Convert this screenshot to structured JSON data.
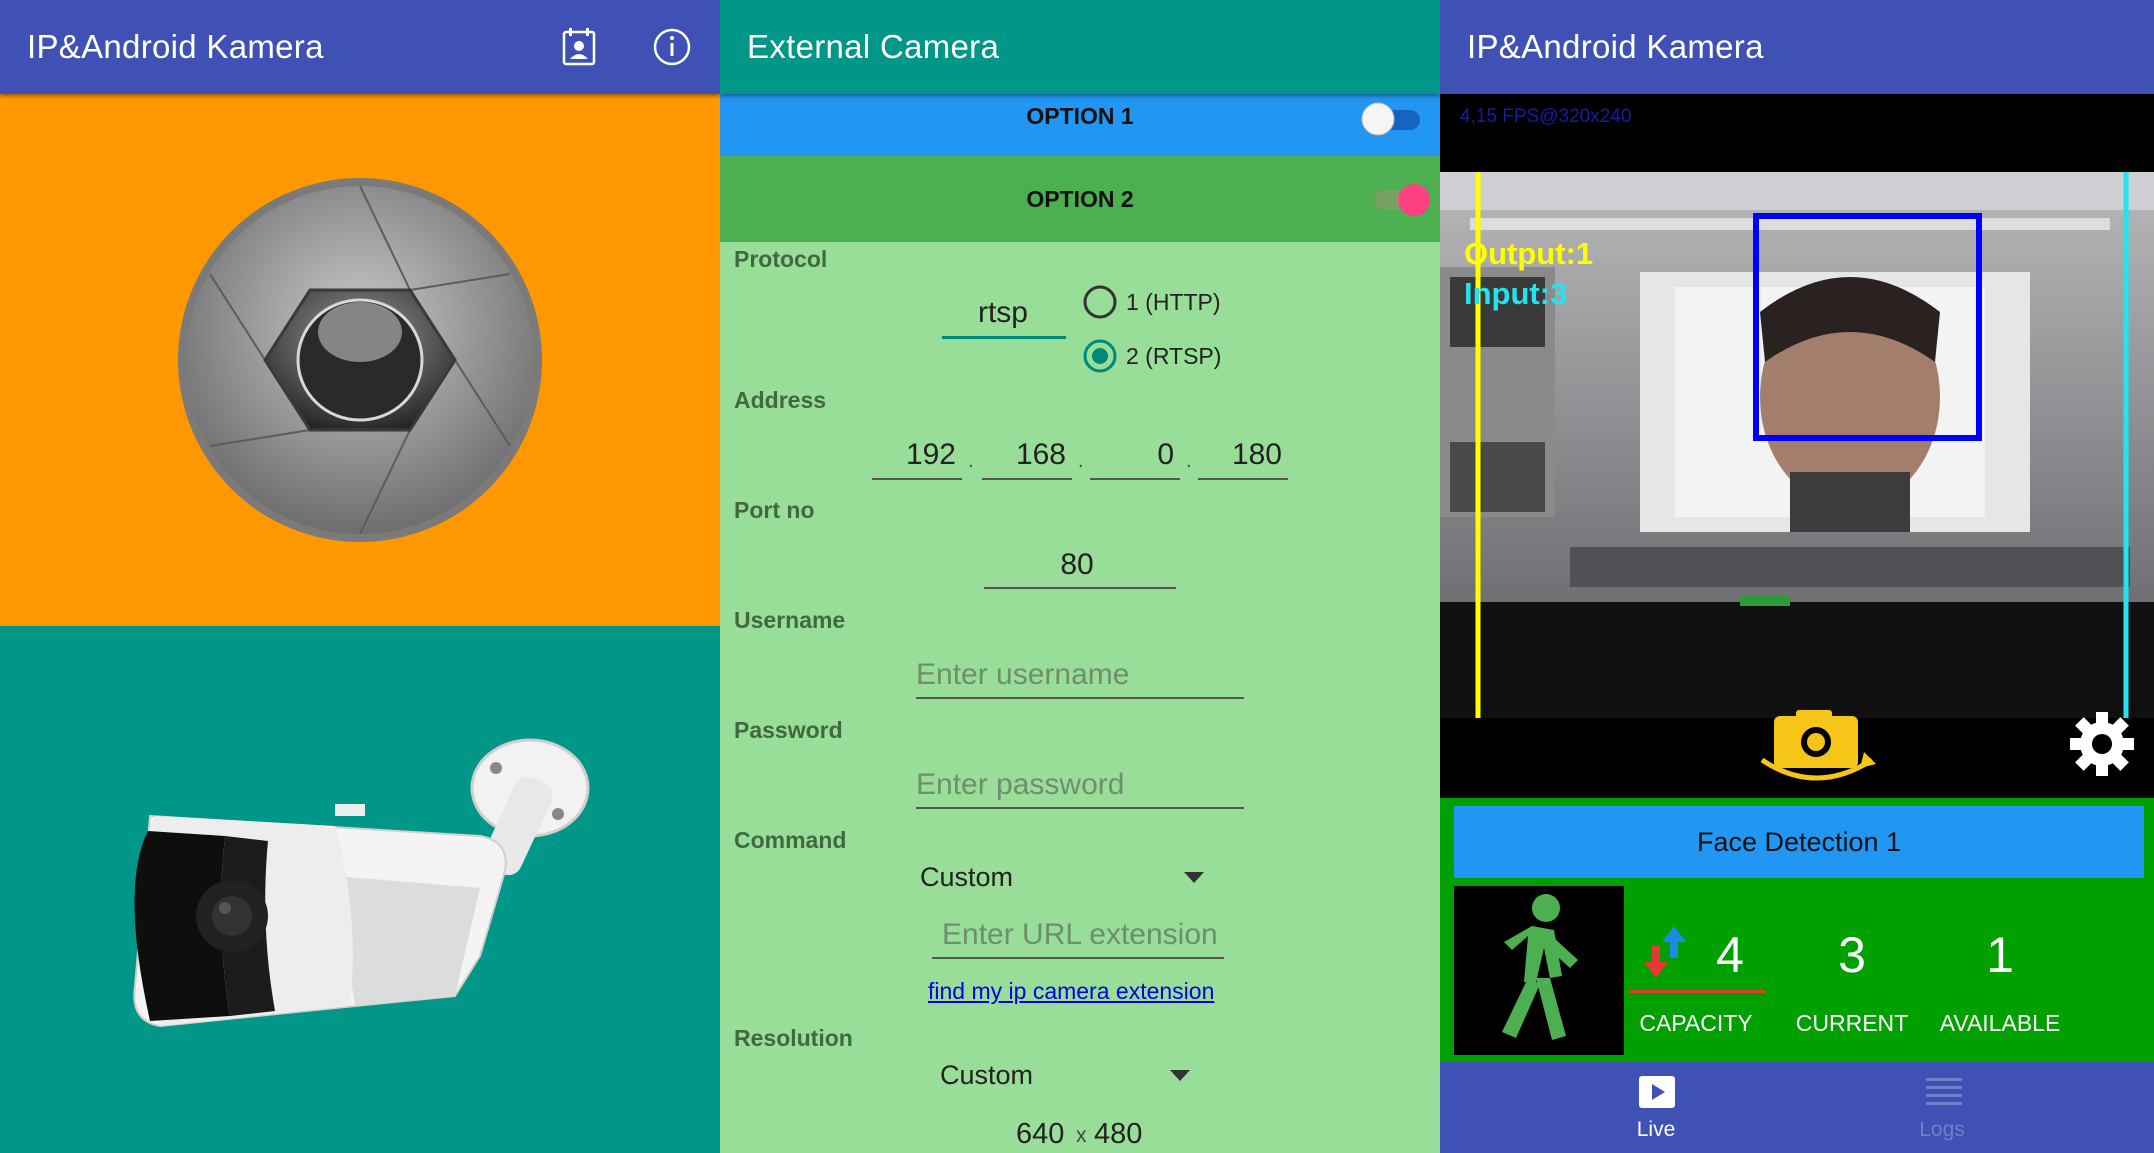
{
  "panel1": {
    "title": "IP&Android Kamera",
    "icons": [
      "contact-calendar-icon",
      "info-icon"
    ],
    "colors": {
      "appbar": "#3f51b5",
      "top_tile": "#ff9800",
      "bottom_tile": "#009688"
    }
  },
  "panel2": {
    "title": "External Camera",
    "option1": {
      "label": "OPTION 1",
      "enabled": false
    },
    "option2": {
      "label": "OPTION 2",
      "enabled": true
    },
    "protocol": {
      "label": "Protocol",
      "value": "rtsp",
      "choices": [
        "1 (HTTP)",
        "2 (RTSP)"
      ],
      "selected": "2 (RTSP)"
    },
    "address": {
      "label": "Address",
      "octets": [
        "192",
        "168",
        "0",
        "180"
      ],
      "separator": "."
    },
    "port": {
      "label": "Port no",
      "value": "80"
    },
    "username": {
      "label": "Username",
      "placeholder": "Enter username"
    },
    "password": {
      "label": "Password",
      "placeholder": "Enter password"
    },
    "command": {
      "label": "Command",
      "selected": "Custom",
      "url_placeholder": "Enter URL extension",
      "link": "find my ip camera extension"
    },
    "resolution": {
      "label": "Resolution",
      "selected": "Custom",
      "width": "640",
      "separator": "x",
      "height": "480"
    }
  },
  "panel3": {
    "title": "IP&Android Kamera",
    "fps_text": "4,15 FPS@320x240",
    "overlay": {
      "output": "Output:1",
      "input": "Input:3"
    },
    "detection_title": "Face Detection 1",
    "stats": [
      {
        "value": "4",
        "label": "CAPACITY"
      },
      {
        "value": "3",
        "label": "CURRENT"
      },
      {
        "value": "1",
        "label": "AVAILABLE"
      }
    ],
    "nav": [
      {
        "label": "Live",
        "icon": "play-video-icon",
        "active": true
      },
      {
        "label": "Logs",
        "icon": "list-icon",
        "active": false
      }
    ]
  }
}
